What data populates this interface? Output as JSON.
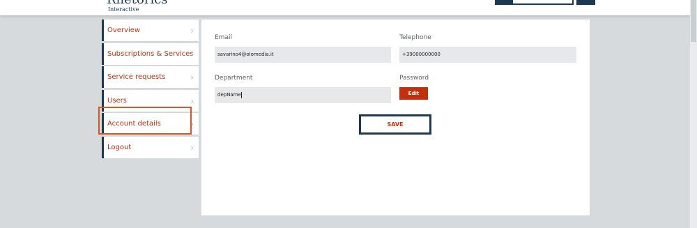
{
  "header": {
    "logo_main": "Rhetorics",
    "logo_sub": "Interactive"
  },
  "sidebar": {
    "items": [
      {
        "label": "Overview"
      },
      {
        "label": "Subscriptions & Services"
      },
      {
        "label": "Service requests"
      },
      {
        "label": "Users"
      },
      {
        "label": "Account details"
      },
      {
        "label": "Logout"
      }
    ],
    "selected": "Account details"
  },
  "form": {
    "email_label": "Email",
    "email_value": "savarino4@olomedia.it",
    "telephone_label": "Telephone",
    "telephone_value": "+39000000000",
    "department_label": "Department",
    "department_value": "depName",
    "password_label": "Password",
    "edit_label": "Edit",
    "save_label": "SAVE"
  },
  "colors": {
    "accent": "#c4300b",
    "navy": "#1b3a52",
    "highlight": "#e1521e"
  }
}
